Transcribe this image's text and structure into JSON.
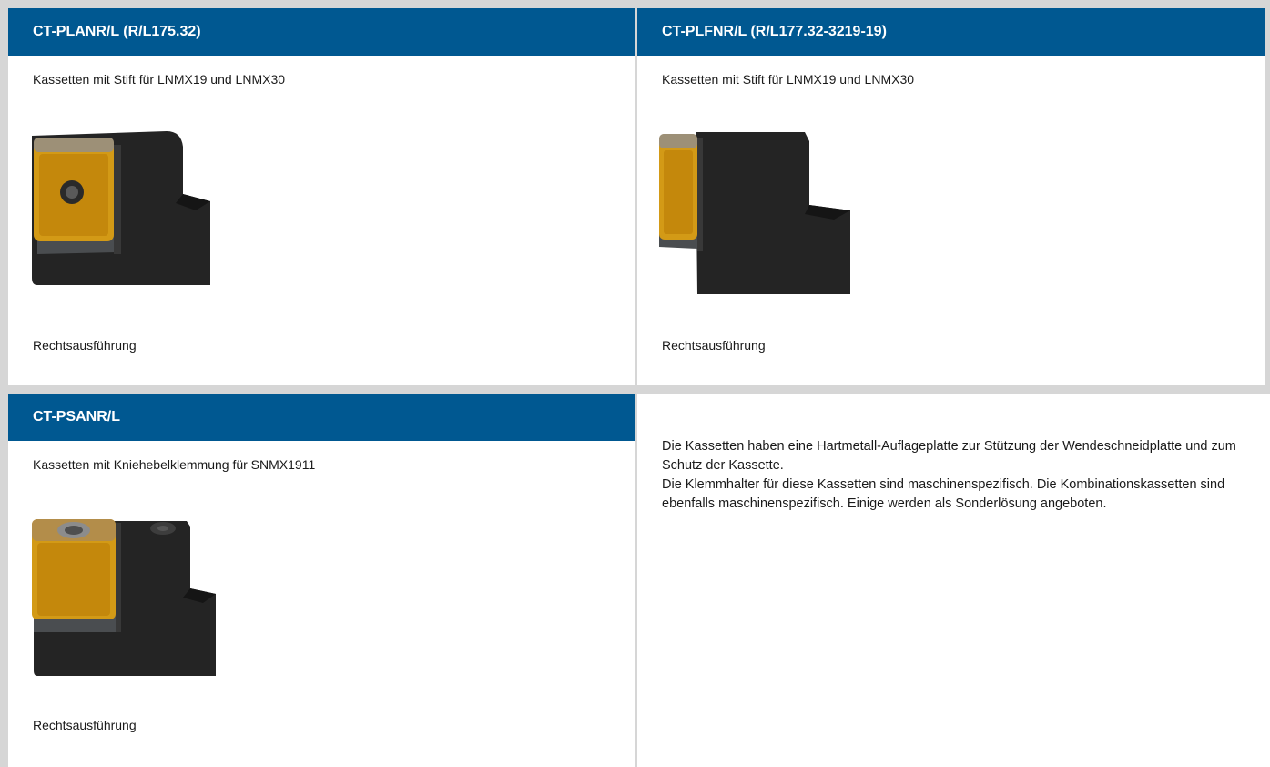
{
  "cells": [
    {
      "title": "CT-PLANR/L (R/L175.32)",
      "description": "Kassetten mit Stift für LNMX19 und LNMX30",
      "variant": "Rechtsausführung"
    },
    {
      "title": "CT-PLFNR/L (R/L177.32-3219-19)",
      "description": "Kassetten mit Stift für LNMX19 und LNMX30",
      "variant": "Rechtsausführung"
    },
    {
      "title": "CT-PSANR/L",
      "description": "Kassetten mit Kniehebelklemmung für SNMX1911",
      "variant": "Rechtsausführung"
    }
  ],
  "info_text": {
    "line1": "Die Kassetten haben eine Hartmetall-Auflageplatte zur Stützung der Wendeschneidplatte und zum Schutz der Kassette.",
    "line2": "Die Klemmhalter für diese Kassetten sind maschinenspezifisch. Die Kombinationskassetten sind ebenfalls maschinenspezifisch. Einige werden als Sonderlösung angeboten."
  },
  "colors": {
    "header_bg": "#005891",
    "header_text": "#ffffff",
    "insert_gold": "#d39a16",
    "cassette_body": "#252525"
  }
}
